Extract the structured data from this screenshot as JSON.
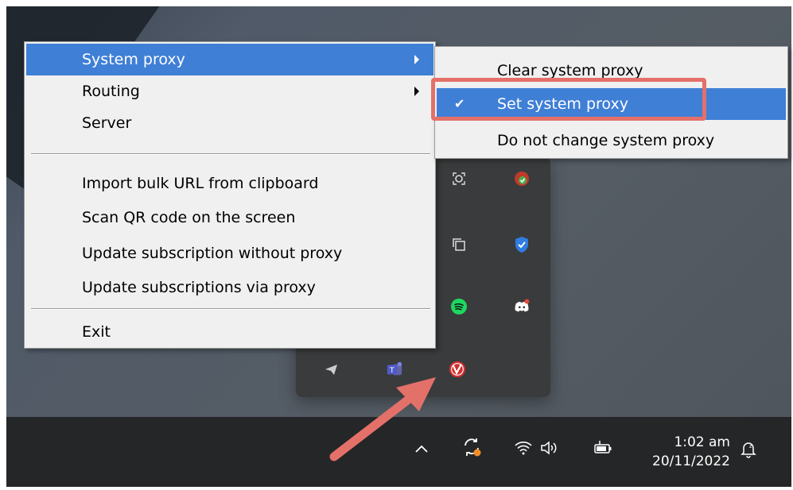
{
  "main_menu": {
    "items": [
      {
        "label": "System proxy",
        "has_submenu": true,
        "selected": true
      },
      {
        "label": "Routing",
        "has_submenu": true
      },
      {
        "label": "Server"
      },
      {
        "label": "Import bulk URL from clipboard"
      },
      {
        "label": "Scan QR code on the screen"
      },
      {
        "label": "Update subscription without proxy"
      },
      {
        "label": "Update subscriptions via proxy"
      },
      {
        "label": "Exit"
      }
    ]
  },
  "sub_menu": {
    "items": [
      {
        "label": "Clear system proxy"
      },
      {
        "label": "Set system proxy",
        "checked": true,
        "selected": true
      },
      {
        "label": "Do not change system proxy"
      }
    ],
    "check_mark": "✔"
  },
  "taskbar": {
    "time": "1:02 am",
    "date": "20/11/2022"
  },
  "colors": {
    "menu_highlight": "#3f7fd6",
    "annotation": "#e4706a",
    "taskbar": "#252627"
  }
}
